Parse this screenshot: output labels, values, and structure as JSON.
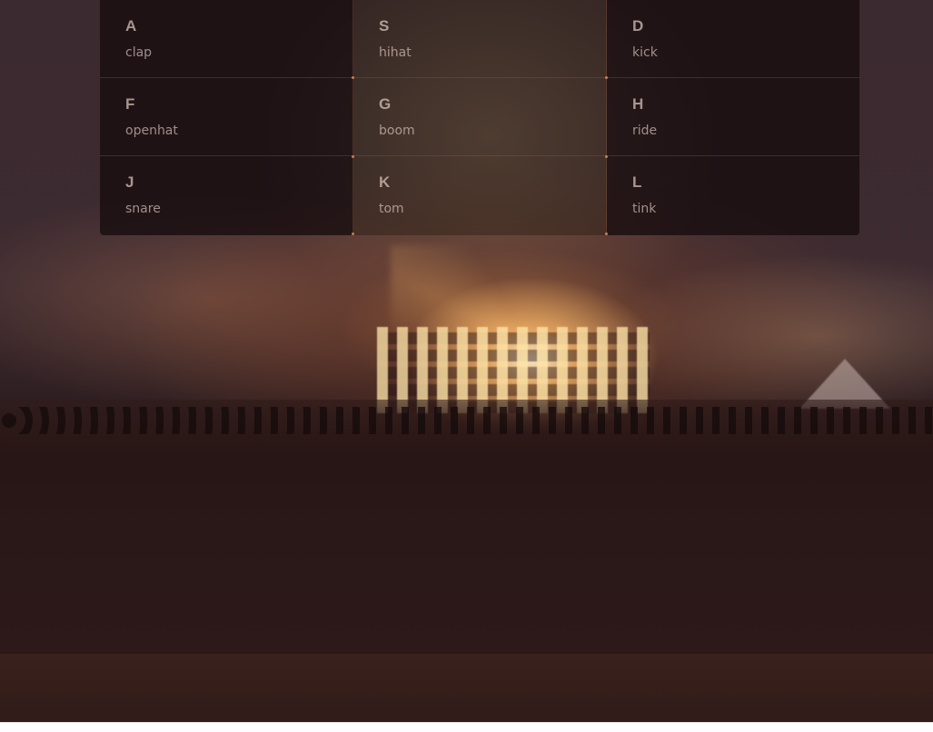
{
  "background": {
    "description_icon": "concert-crowd-stage-lights-image",
    "accent_color": "#e0964f"
  },
  "keys": [
    {
      "letter": "A",
      "sound": "clap"
    },
    {
      "letter": "S",
      "sound": "hihat"
    },
    {
      "letter": "D",
      "sound": "kick"
    },
    {
      "letter": "F",
      "sound": "openhat"
    },
    {
      "letter": "G",
      "sound": "boom"
    },
    {
      "letter": "H",
      "sound": "ride"
    },
    {
      "letter": "J",
      "sound": "snare"
    },
    {
      "letter": "K",
      "sound": "tom"
    },
    {
      "letter": "L",
      "sound": "tink"
    }
  ]
}
